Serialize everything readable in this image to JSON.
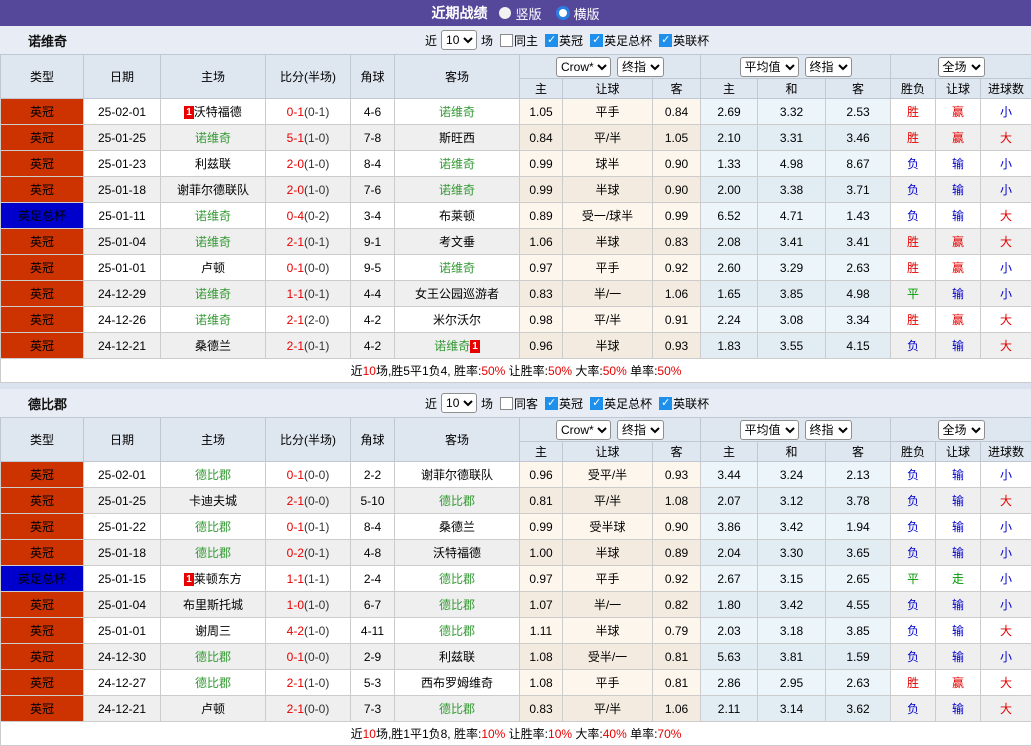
{
  "title_bar": {
    "title": "近期战绩",
    "radios": [
      {
        "label": "竖版",
        "selected": false
      },
      {
        "label": "横版",
        "selected": true
      }
    ]
  },
  "controls": {
    "near_label": "近",
    "near_value": "10",
    "games_label": "场",
    "league_filters": [
      "英冠",
      "英足总杯",
      "英联杯"
    ]
  },
  "table_header": {
    "static_cols": [
      "类型",
      "日期",
      "主场",
      "比分(半场)",
      "角球",
      "客场"
    ],
    "selects": [
      "Crow*",
      "终指",
      "平均值",
      "终指",
      "全场"
    ],
    "sub_cols": [
      "主",
      "让球",
      "客",
      "主",
      "和",
      "客",
      "胜负",
      "让球",
      "进球数"
    ]
  },
  "colors": {
    "topbar_bg": "#55489b",
    "page_bg": "#d9e2ee",
    "section_bar_bg": "#e8edf5",
    "header_bg": "#dee6f0",
    "row_alt_bg": "#efefef",
    "crow_col_bg": "#fdf6ed",
    "crow_col_alt_bg": "#f3ebe0",
    "avg_col_bg": "#ebf5fa",
    "avg_col_alt_bg": "#e2edf3",
    "focus_team": "#339933",
    "red": "#e60000",
    "blue": "#0000cc",
    "green": "#009900",
    "badge_bg": "#e80000",
    "league_colors": {
      "英冠": "#cc3300",
      "英足总杯": "#0000cc"
    }
  },
  "result_colors": {
    "胜": "red",
    "负": "blue",
    "平": "green",
    "赢": "red",
    "输": "blue",
    "走": "green",
    "大": "red",
    "小": "blue"
  },
  "sections": [
    {
      "team": "诺维奇",
      "same_venue_label": "同主",
      "rows": [
        {
          "type": "英冠",
          "date": "25-02-01",
          "home": "沃特福德",
          "home_focus": false,
          "home_badge": "1",
          "score": "0-1",
          "half": "(0-1)",
          "corner": "4-6",
          "away": "诺维奇",
          "away_focus": true,
          "away_badge": "",
          "crow_home": "1.05",
          "handicap": "平手",
          "crow_away": "0.84",
          "avg_home": "2.69",
          "avg_draw": "3.32",
          "avg_away": "2.53",
          "result": "胜",
          "handicap_result": "赢",
          "goals": "小"
        },
        {
          "type": "英冠",
          "date": "25-01-25",
          "home": "诺维奇",
          "home_focus": true,
          "home_badge": "",
          "score": "5-1",
          "half": "(1-0)",
          "corner": "7-8",
          "away": "斯旺西",
          "away_focus": false,
          "away_badge": "",
          "crow_home": "0.84",
          "handicap": "平/半",
          "crow_away": "1.05",
          "avg_home": "2.10",
          "avg_draw": "3.31",
          "avg_away": "3.46",
          "result": "胜",
          "handicap_result": "赢",
          "goals": "大"
        },
        {
          "type": "英冠",
          "date": "25-01-23",
          "home": "利兹联",
          "home_focus": false,
          "home_badge": "",
          "score": "2-0",
          "half": "(1-0)",
          "corner": "8-4",
          "away": "诺维奇",
          "away_focus": true,
          "away_badge": "",
          "crow_home": "0.99",
          "handicap": "球半",
          "crow_away": "0.90",
          "avg_home": "1.33",
          "avg_draw": "4.98",
          "avg_away": "8.67",
          "result": "负",
          "handicap_result": "输",
          "goals": "小"
        },
        {
          "type": "英冠",
          "date": "25-01-18",
          "home": "谢菲尔德联队",
          "home_focus": false,
          "home_badge": "",
          "score": "2-0",
          "half": "(1-0)",
          "corner": "7-6",
          "away": "诺维奇",
          "away_focus": true,
          "away_badge": "",
          "crow_home": "0.99",
          "handicap": "半球",
          "crow_away": "0.90",
          "avg_home": "2.00",
          "avg_draw": "3.38",
          "avg_away": "3.71",
          "result": "负",
          "handicap_result": "输",
          "goals": "小"
        },
        {
          "type": "英足总杯",
          "date": "25-01-11",
          "home": "诺维奇",
          "home_focus": true,
          "home_badge": "",
          "score": "0-4",
          "half": "(0-2)",
          "corner": "3-4",
          "away": "布莱顿",
          "away_focus": false,
          "away_badge": "",
          "crow_home": "0.89",
          "handicap": "受一/球半",
          "crow_away": "0.99",
          "avg_home": "6.52",
          "avg_draw": "4.71",
          "avg_away": "1.43",
          "result": "负",
          "handicap_result": "输",
          "goals": "大"
        },
        {
          "type": "英冠",
          "date": "25-01-04",
          "home": "诺维奇",
          "home_focus": true,
          "home_badge": "",
          "score": "2-1",
          "half": "(0-1)",
          "corner": "9-1",
          "away": "考文垂",
          "away_focus": false,
          "away_badge": "",
          "crow_home": "1.06",
          "handicap": "半球",
          "crow_away": "0.83",
          "avg_home": "2.08",
          "avg_draw": "3.41",
          "avg_away": "3.41",
          "result": "胜",
          "handicap_result": "赢",
          "goals": "大"
        },
        {
          "type": "英冠",
          "date": "25-01-01",
          "home": "卢顿",
          "home_focus": false,
          "home_badge": "",
          "score": "0-1",
          "half": "(0-0)",
          "corner": "9-5",
          "away": "诺维奇",
          "away_focus": true,
          "away_badge": "",
          "crow_home": "0.97",
          "handicap": "平手",
          "crow_away": "0.92",
          "avg_home": "2.60",
          "avg_draw": "3.29",
          "avg_away": "2.63",
          "result": "胜",
          "handicap_result": "赢",
          "goals": "小"
        },
        {
          "type": "英冠",
          "date": "24-12-29",
          "home": "诺维奇",
          "home_focus": true,
          "home_badge": "",
          "score": "1-1",
          "half": "(0-1)",
          "corner": "4-4",
          "away": "女王公园巡游者",
          "away_focus": false,
          "away_badge": "",
          "crow_home": "0.83",
          "handicap": "半/一",
          "crow_away": "1.06",
          "avg_home": "1.65",
          "avg_draw": "3.85",
          "avg_away": "4.98",
          "result": "平",
          "handicap_result": "输",
          "goals": "小"
        },
        {
          "type": "英冠",
          "date": "24-12-26",
          "home": "诺维奇",
          "home_focus": true,
          "home_badge": "",
          "score": "2-1",
          "half": "(2-0)",
          "corner": "4-2",
          "away": "米尔沃尔",
          "away_focus": false,
          "away_badge": "",
          "crow_home": "0.98",
          "handicap": "平/半",
          "crow_away": "0.91",
          "avg_home": "2.24",
          "avg_draw": "3.08",
          "avg_away": "3.34",
          "result": "胜",
          "handicap_result": "赢",
          "goals": "大"
        },
        {
          "type": "英冠",
          "date": "24-12-21",
          "home": "桑德兰",
          "home_focus": false,
          "home_badge": "",
          "score": "2-1",
          "half": "(0-1)",
          "corner": "4-2",
          "away": "诺维奇",
          "away_focus": true,
          "away_badge": "1",
          "crow_home": "0.96",
          "handicap": "半球",
          "crow_away": "0.93",
          "avg_home": "1.83",
          "avg_draw": "3.55",
          "avg_away": "4.15",
          "result": "负",
          "handicap_result": "输",
          "goals": "大"
        }
      ],
      "summary_parts": [
        {
          "text": "近",
          "red": false
        },
        {
          "text": "10",
          "red": true
        },
        {
          "text": "场,胜5平1负4, 胜率:",
          "red": false
        },
        {
          "text": "50%",
          "red": true
        },
        {
          "text": " 让胜率:",
          "red": false
        },
        {
          "text": "50%",
          "red": true
        },
        {
          "text": " 大率:",
          "red": false
        },
        {
          "text": "50%",
          "red": true
        },
        {
          "text": " 单率:",
          "red": false
        },
        {
          "text": "50%",
          "red": true
        }
      ]
    },
    {
      "team": "德比郡",
      "same_venue_label": "同客",
      "rows": [
        {
          "type": "英冠",
          "date": "25-02-01",
          "home": "德比郡",
          "home_focus": true,
          "home_badge": "",
          "score": "0-1",
          "half": "(0-0)",
          "corner": "2-2",
          "away": "谢菲尔德联队",
          "away_focus": false,
          "away_badge": "",
          "crow_home": "0.96",
          "handicap": "受平/半",
          "crow_away": "0.93",
          "avg_home": "3.44",
          "avg_draw": "3.24",
          "avg_away": "2.13",
          "result": "负",
          "handicap_result": "输",
          "goals": "小"
        },
        {
          "type": "英冠",
          "date": "25-01-25",
          "home": "卡迪夫城",
          "home_focus": false,
          "home_badge": "",
          "score": "2-1",
          "half": "(0-0)",
          "corner": "5-10",
          "away": "德比郡",
          "away_focus": true,
          "away_badge": "",
          "crow_home": "0.81",
          "handicap": "平/半",
          "crow_away": "1.08",
          "avg_home": "2.07",
          "avg_draw": "3.12",
          "avg_away": "3.78",
          "result": "负",
          "handicap_result": "输",
          "goals": "大"
        },
        {
          "type": "英冠",
          "date": "25-01-22",
          "home": "德比郡",
          "home_focus": true,
          "home_badge": "",
          "score": "0-1",
          "half": "(0-1)",
          "corner": "8-4",
          "away": "桑德兰",
          "away_focus": false,
          "away_badge": "",
          "crow_home": "0.99",
          "handicap": "受半球",
          "crow_away": "0.90",
          "avg_home": "3.86",
          "avg_draw": "3.42",
          "avg_away": "1.94",
          "result": "负",
          "handicap_result": "输",
          "goals": "小"
        },
        {
          "type": "英冠",
          "date": "25-01-18",
          "home": "德比郡",
          "home_focus": true,
          "home_badge": "",
          "score": "0-2",
          "half": "(0-1)",
          "corner": "4-8",
          "away": "沃特福德",
          "away_focus": false,
          "away_badge": "",
          "crow_home": "1.00",
          "handicap": "半球",
          "crow_away": "0.89",
          "avg_home": "2.04",
          "avg_draw": "3.30",
          "avg_away": "3.65",
          "result": "负",
          "handicap_result": "输",
          "goals": "小"
        },
        {
          "type": "英足总杯",
          "date": "25-01-15",
          "home": "莱顿东方",
          "home_focus": false,
          "home_badge": "1",
          "score": "1-1",
          "half": "(1-1)",
          "corner": "2-4",
          "away": "德比郡",
          "away_focus": true,
          "away_badge": "",
          "crow_home": "0.97",
          "handicap": "平手",
          "crow_away": "0.92",
          "avg_home": "2.67",
          "avg_draw": "3.15",
          "avg_away": "2.65",
          "result": "平",
          "handicap_result": "走",
          "goals": "小"
        },
        {
          "type": "英冠",
          "date": "25-01-04",
          "home": "布里斯托城",
          "home_focus": false,
          "home_badge": "",
          "score": "1-0",
          "half": "(1-0)",
          "corner": "6-7",
          "away": "德比郡",
          "away_focus": true,
          "away_badge": "",
          "crow_home": "1.07",
          "handicap": "半/一",
          "crow_away": "0.82",
          "avg_home": "1.80",
          "avg_draw": "3.42",
          "avg_away": "4.55",
          "result": "负",
          "handicap_result": "输",
          "goals": "小"
        },
        {
          "type": "英冠",
          "date": "25-01-01",
          "home": "谢周三",
          "home_focus": false,
          "home_badge": "",
          "score": "4-2",
          "half": "(1-0)",
          "corner": "4-11",
          "away": "德比郡",
          "away_focus": true,
          "away_badge": "",
          "crow_home": "1.11",
          "handicap": "半球",
          "crow_away": "0.79",
          "avg_home": "2.03",
          "avg_draw": "3.18",
          "avg_away": "3.85",
          "result": "负",
          "handicap_result": "输",
          "goals": "大"
        },
        {
          "type": "英冠",
          "date": "24-12-30",
          "home": "德比郡",
          "home_focus": true,
          "home_badge": "",
          "score": "0-1",
          "half": "(0-0)",
          "corner": "2-9",
          "away": "利兹联",
          "away_focus": false,
          "away_badge": "",
          "crow_home": "1.08",
          "handicap": "受半/一",
          "crow_away": "0.81",
          "avg_home": "5.63",
          "avg_draw": "3.81",
          "avg_away": "1.59",
          "result": "负",
          "handicap_result": "输",
          "goals": "小"
        },
        {
          "type": "英冠",
          "date": "24-12-27",
          "home": "德比郡",
          "home_focus": true,
          "home_badge": "",
          "score": "2-1",
          "half": "(1-0)",
          "corner": "5-3",
          "away": "西布罗姆维奇",
          "away_focus": false,
          "away_badge": "",
          "crow_home": "1.08",
          "handicap": "平手",
          "crow_away": "0.81",
          "avg_home": "2.86",
          "avg_draw": "2.95",
          "avg_away": "2.63",
          "result": "胜",
          "handicap_result": "赢",
          "goals": "大"
        },
        {
          "type": "英冠",
          "date": "24-12-21",
          "home": "卢顿",
          "home_focus": false,
          "home_badge": "",
          "score": "2-1",
          "half": "(0-0)",
          "corner": "7-3",
          "away": "德比郡",
          "away_focus": true,
          "away_badge": "",
          "crow_home": "0.83",
          "handicap": "平/半",
          "crow_away": "1.06",
          "avg_home": "2.11",
          "avg_draw": "3.14",
          "avg_away": "3.62",
          "result": "负",
          "handicap_result": "输",
          "goals": "大"
        }
      ],
      "summary_parts": [
        {
          "text": "近",
          "red": false
        },
        {
          "text": "10",
          "red": true
        },
        {
          "text": "场,胜1平1负8, 胜率:",
          "red": false
        },
        {
          "text": "10%",
          "red": true
        },
        {
          "text": " 让胜率:",
          "red": false
        },
        {
          "text": "10%",
          "red": true
        },
        {
          "text": " 大率:",
          "red": false
        },
        {
          "text": "40%",
          "red": true
        },
        {
          "text": " 单率:",
          "red": false
        },
        {
          "text": "70%",
          "red": true
        }
      ]
    }
  ]
}
